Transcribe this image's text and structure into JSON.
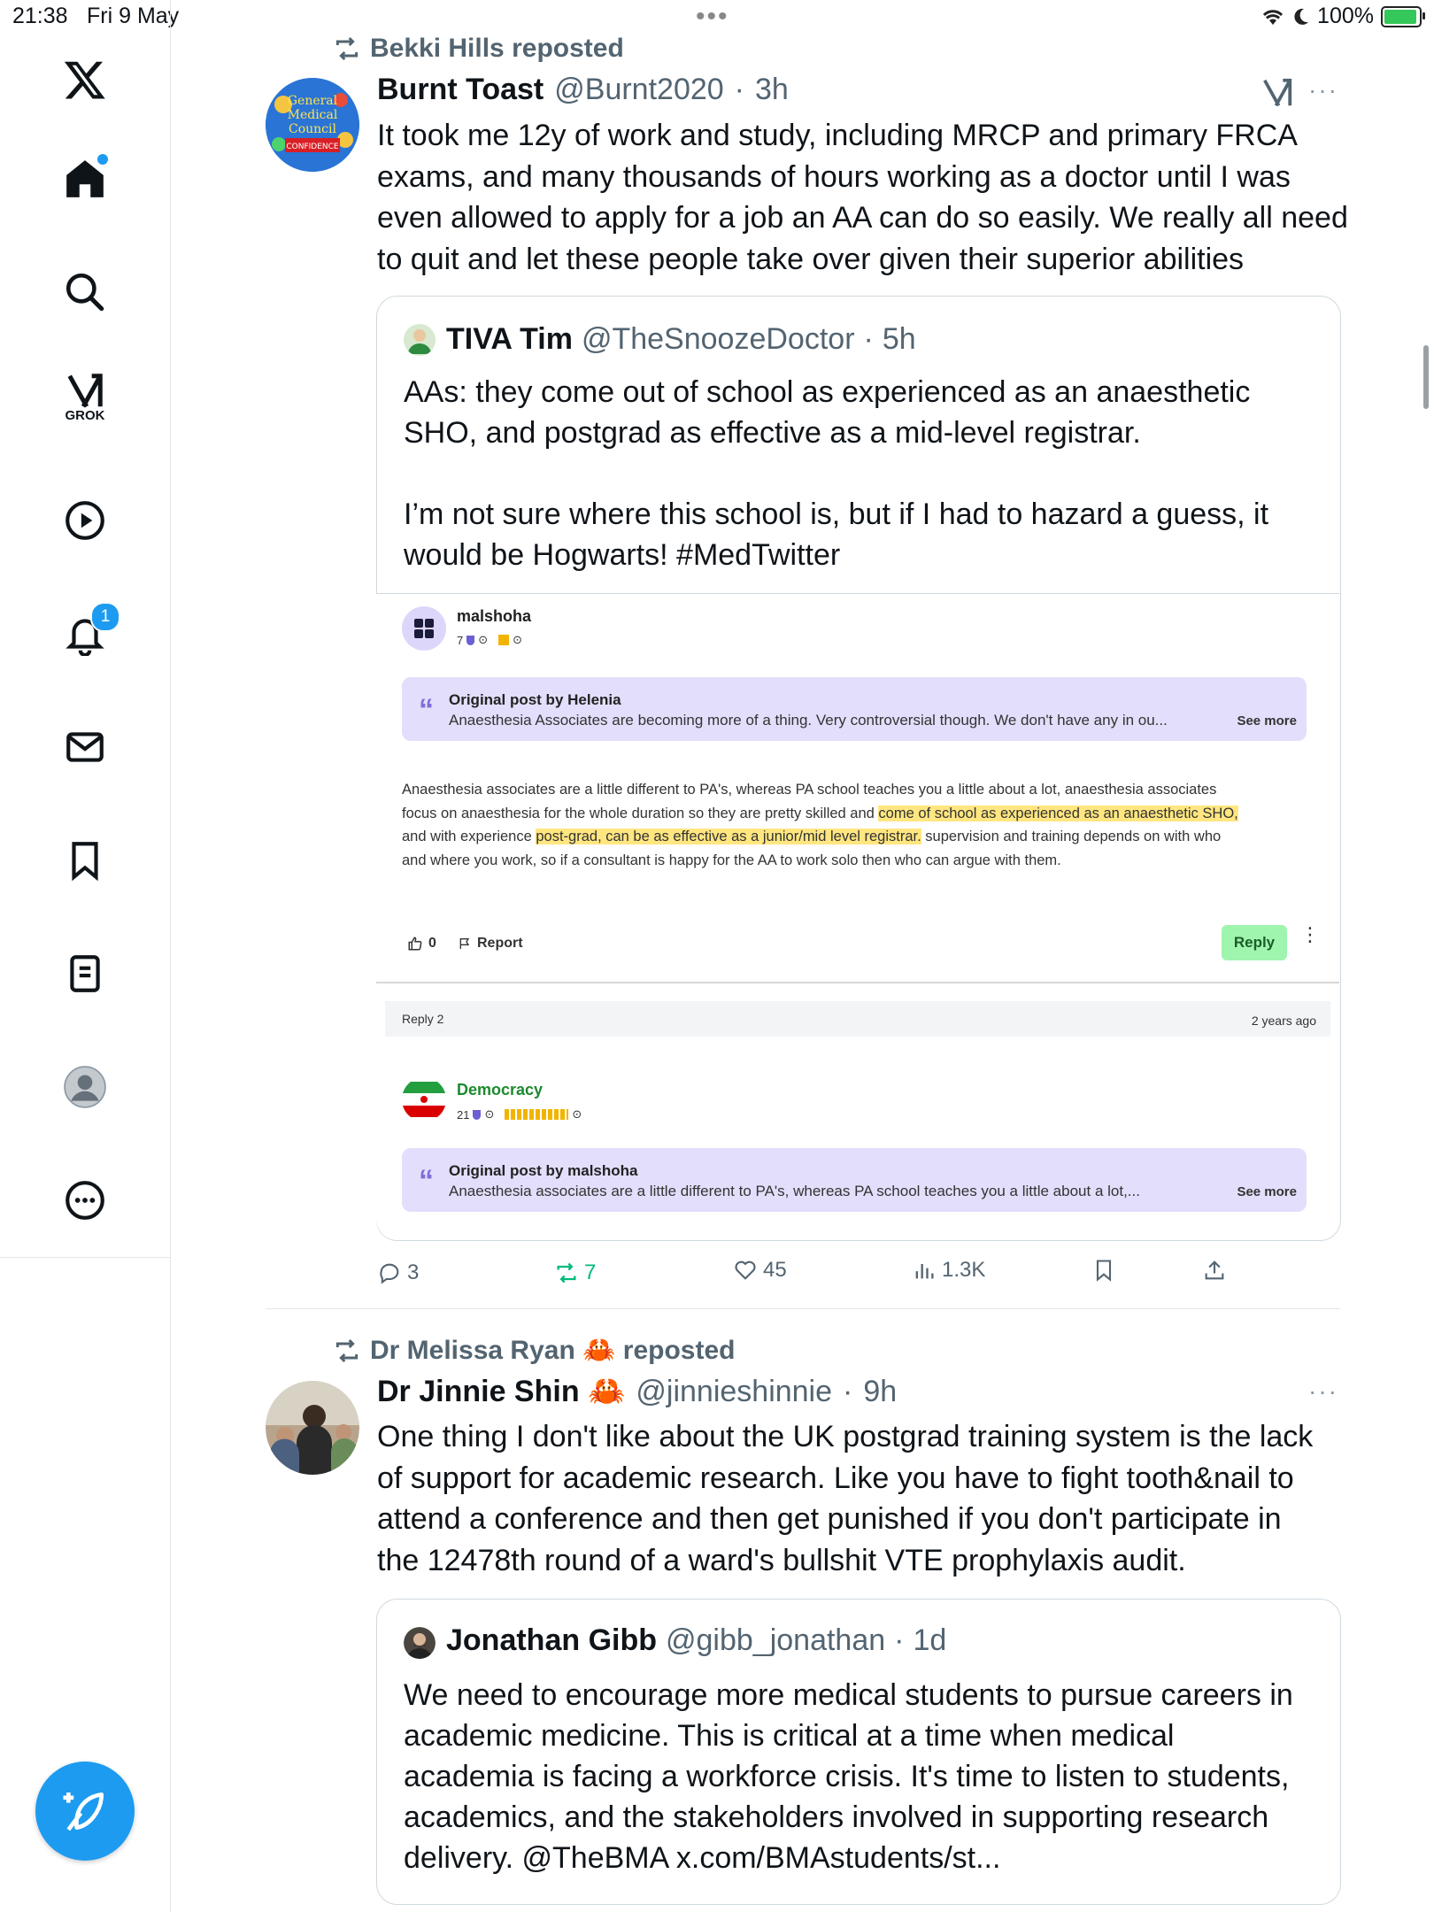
{
  "status_bar": {
    "time": "21:38",
    "date": "Fri 9 May",
    "battery": "100%",
    "battery_level": 1.0
  },
  "sidebar": {
    "grok_label": "GROK",
    "notifications_count": "1",
    "items": [
      "x-logo",
      "home",
      "search",
      "grok",
      "video",
      "notifications",
      "messages",
      "bookmarks",
      "lists",
      "profile",
      "more"
    ]
  },
  "feed": {
    "post1": {
      "repost_by": "Bekki Hills reposted",
      "name": "Burnt Toast",
      "handle": "@Burnt2020",
      "time": "3h",
      "text_lines": [
        "It took me 12y of work and study, including MRCP and primary FRCA",
        "exams, and many thousands of hours working as a doctor until I was",
        "even allowed to apply for a job an AA can do so easily. We really all need",
        "to quit and let these people take over given their superior abilities"
      ],
      "quote": {
        "name": "TIVA Tim",
        "handle": "@TheSnoozeDoctor",
        "time": "5h",
        "text_lines": [
          "AAs: they come out of school as experienced as an anaesthetic",
          "SHO, and postgrad as effective as a mid-level registrar.",
          "",
          "I’m not sure where this school is, but if I had to hazard a guess, it",
          "would be Hogwarts! #MedTwitter"
        ]
      },
      "embed": {
        "user1": "malshoha",
        "user1_stats": "7",
        "quote1_title": "Original post by Helenia",
        "quote1_text": "Anaesthesia Associates are becoming more of a thing. Very controversial though. We don't have any in ou...",
        "see_more": "See more",
        "para_l1a": "Anaesthesia associates are a little different to PA's, whereas PA school teaches you a little about a lot, anaesthesia associates",
        "para_l2a": "focus on anaesthesia for the whole duration so they are pretty skilled and ",
        "para_l2b": "come of school as experienced as an anaesthetic SHO,",
        "para_l3a": "and with experience ",
        "para_l3b": "post-grad, can be as effective as a junior/mid level registrar.",
        "para_l3c": " supervision and training depends on with who",
        "para_l4": "and where you work, so if a consultant is happy for the AA to work solo then who can argue with them.",
        "like_count": "0",
        "report": "Report",
        "reply_button": "Reply",
        "reply_header": "Reply 2",
        "reply_time": "2 years ago",
        "user2": "Democracy",
        "user2_stats": "21",
        "quote2_title": "Original post by malshoha",
        "quote2_text": "Anaesthesia associates are a little different to PA's, whereas PA school teaches you a little about a lot,..."
      },
      "actions": {
        "replies": "3",
        "reposts": "7",
        "likes": "45",
        "views": "1.3K"
      }
    },
    "post2": {
      "repost_by": "Dr Melissa Ryan 🦀 reposted",
      "name": "Dr Jinnie Shin 🦀",
      "handle": "@jinnieshinnie",
      "time": "9h",
      "text_lines": [
        "One thing I don't like about the UK postgrad training system is the lack",
        "of support for academic research. Like you have to fight tooth&nail to",
        "attend a conference and then get punished if you don't participate in",
        "the 12478th round of a ward's bullshit VTE prophylaxis audit."
      ],
      "quote": {
        "name": "Jonathan Gibb",
        "handle": "@gibb_jonathan",
        "time": "1d",
        "text_lines": [
          "We need to encourage more medical students to pursue careers in",
          "academic medicine. This is critical at a time when medical",
          "academia is facing a workforce crisis. It's time to listen to students,",
          "academics, and the stakeholders involved in supporting research",
          "delivery. @TheBMA x.com/BMAstudents/st..."
        ]
      }
    }
  },
  "colors": {
    "accent": "#1d9bf0",
    "repost_green": "#00ba7c",
    "muted": "#536471",
    "quote_purple": "#e3defb",
    "highlight": "#ffe680"
  }
}
